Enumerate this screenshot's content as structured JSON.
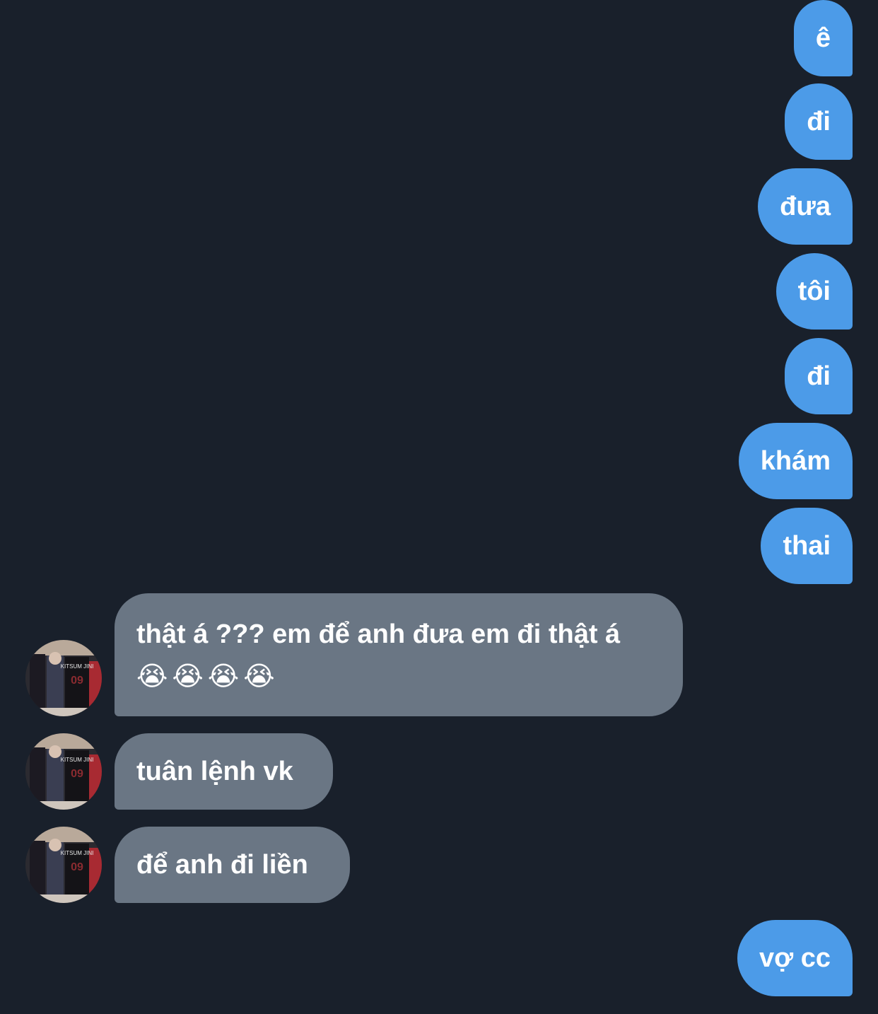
{
  "colors": {
    "background": "#19202b",
    "outgoing_bubble": "#4c9be8",
    "incoming_bubble": "#6a7684",
    "text": "#ffffff"
  },
  "outgoing_messages": [
    "ê",
    "đi",
    "đưa",
    "tôi",
    "đi",
    "khám",
    "thai"
  ],
  "incoming_messages": [
    "thật á ??? em để anh đưa em đi thật á",
    "tuân lệnh vk",
    "để anh đi liền"
  ],
  "incoming_emoji": "😭😭😭😭",
  "last_outgoing": "vợ cc",
  "avatar": {
    "icon": "contact-avatar",
    "jersey_text": "KITSUM JINI",
    "jersey_number": "09"
  }
}
